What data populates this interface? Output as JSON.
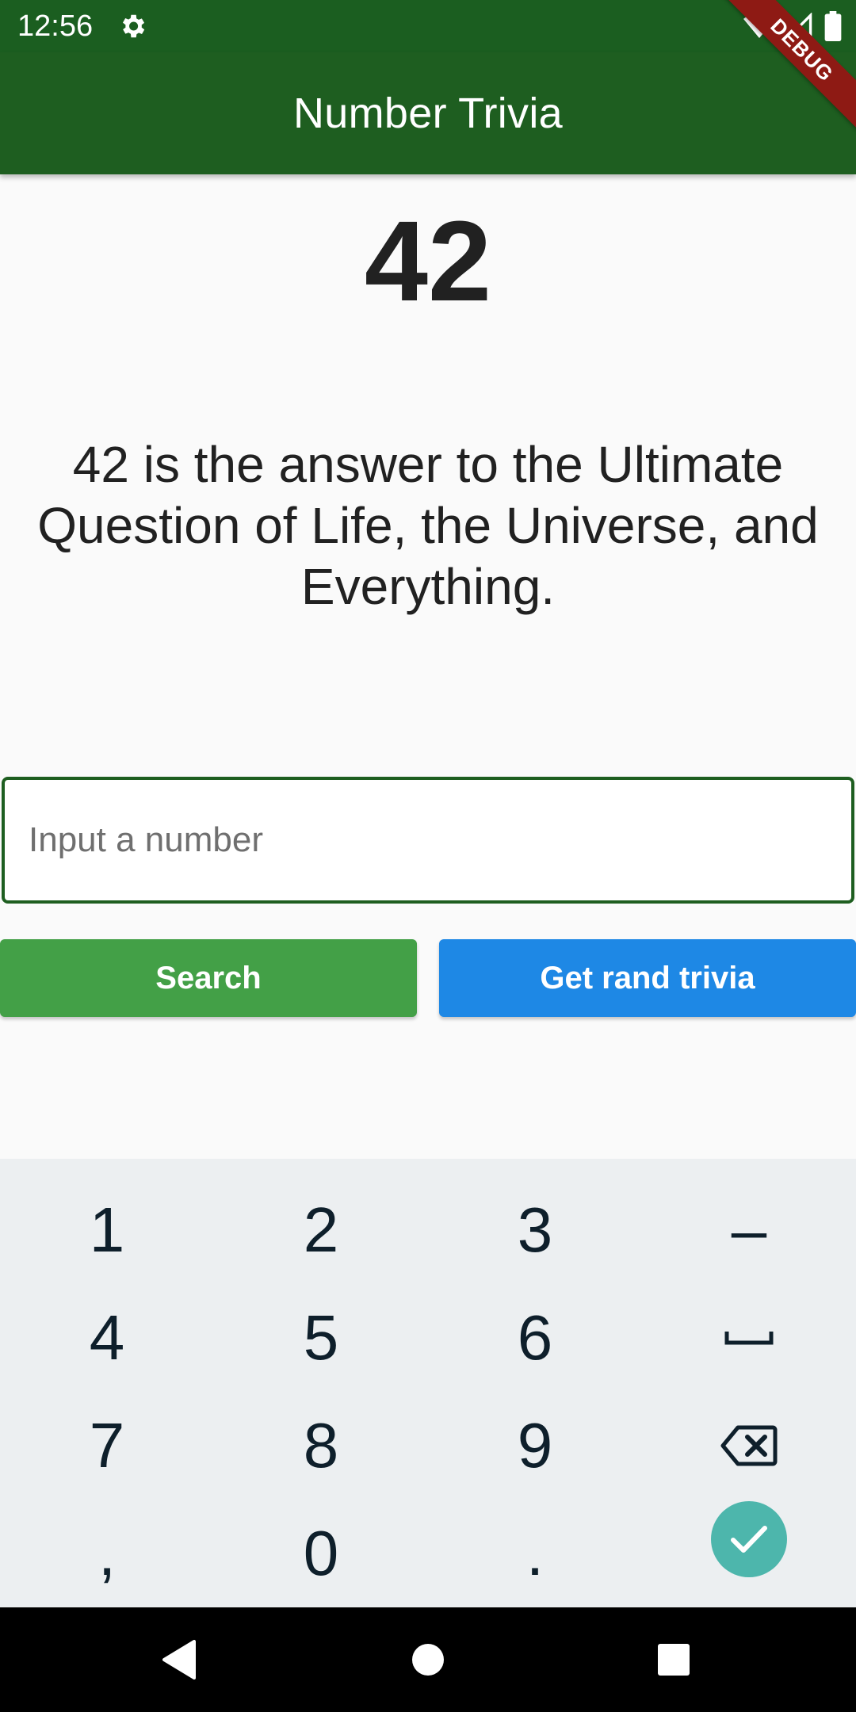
{
  "status_bar": {
    "time": "12:56",
    "icons": [
      "gear-icon",
      "wifi-icon",
      "signal-icon",
      "battery-icon"
    ]
  },
  "app_bar": {
    "title": "Number Trivia"
  },
  "debug_banner": {
    "label": "DEBUG"
  },
  "trivia": {
    "number": "42",
    "text": "42 is the answer to the Ultimate Question of Life, the Universe, and Everything."
  },
  "input": {
    "placeholder": "Input a number",
    "value": ""
  },
  "buttons": {
    "search_label": "Search",
    "random_label": "Get rand trivia"
  },
  "keyboard": {
    "rows": [
      [
        "1",
        "2",
        "3",
        "–"
      ],
      [
        "4",
        "5",
        "6",
        "space-icon"
      ],
      [
        "7",
        "8",
        "9",
        "backspace-icon"
      ],
      [
        ",",
        "0",
        ".",
        "done-check-icon"
      ]
    ]
  },
  "colors": {
    "primary_dark": "#1b5e20",
    "primary": "#1e5e20",
    "search_button": "#43a047",
    "random_button": "#1e88e5",
    "keyboard_bg": "#eceff1",
    "done_key": "#4db6ac",
    "debug_ribbon": "#8e1a14"
  },
  "nav_bar": {
    "buttons": [
      "back-icon",
      "home-icon",
      "recents-icon"
    ]
  }
}
